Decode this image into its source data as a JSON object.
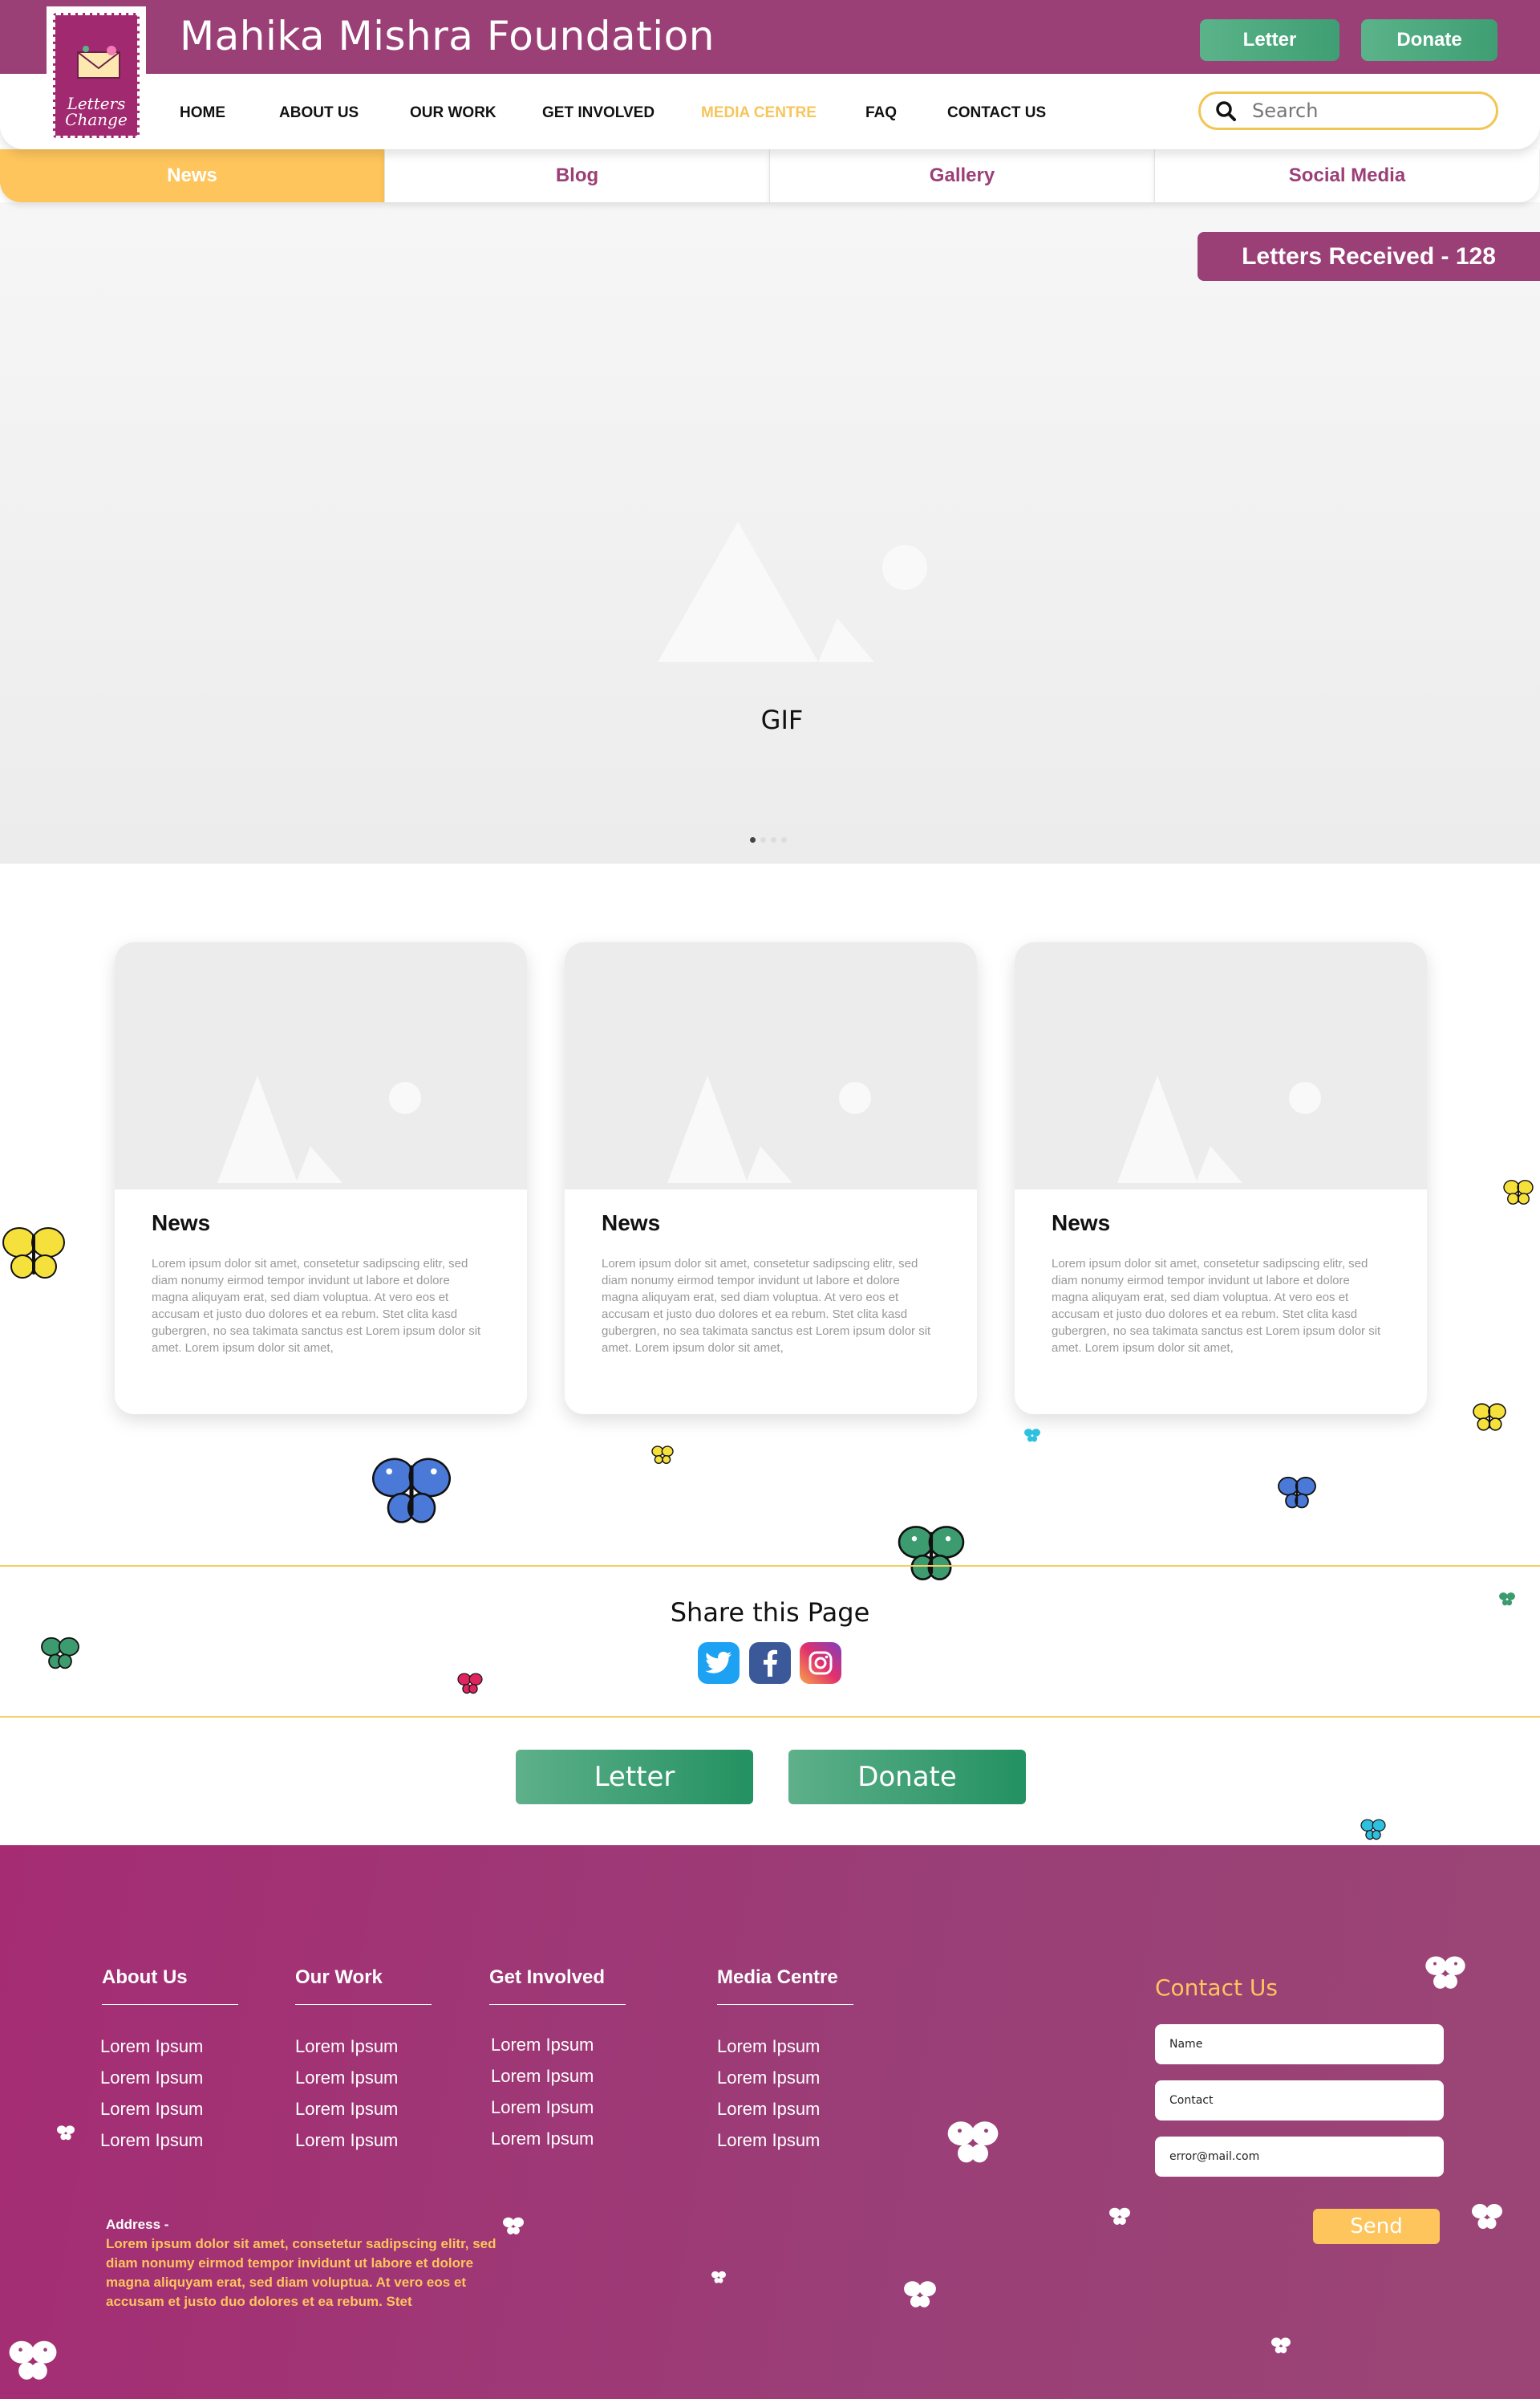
{
  "header": {
    "logo_text_line1": "Letters",
    "logo_text_line2": "Change",
    "title": "Mahika Mishra Foundation",
    "letter_button": "Letter",
    "donate_button": "Donate"
  },
  "nav": {
    "items": [
      "HOME",
      "ABOUT US",
      "OUR WORK",
      "GET INVOLVED",
      "MEDIA CENTRE",
      "FAQ",
      "CONTACT US"
    ],
    "active": "MEDIA CENTRE",
    "search_placeholder": "Search"
  },
  "subtabs": [
    "News",
    "Blog",
    "Gallery",
    "Social Media"
  ],
  "hero": {
    "badge": "Letters Received - 128",
    "caption": "GIF"
  },
  "cards": [
    {
      "title": "News",
      "body": "Lorem ipsum dolor sit amet, consetetur sadipscing elitr, sed diam nonumy eirmod tempor invidunt ut labore et dolore magna aliquyam erat, sed diam voluptua. At vero eos et accusam et justo duo dolores et ea rebum. Stet clita kasd gubergren, no sea takimata sanctus est Lorem ipsum dolor sit amet. Lorem ipsum dolor sit amet,"
    },
    {
      "title": "News",
      "body": "Lorem ipsum dolor sit amet, consetetur sadipscing elitr, sed diam nonumy eirmod tempor invidunt ut labore et dolore magna aliquyam erat, sed diam voluptua. At vero eos et accusam et justo duo dolores et ea rebum. Stet clita kasd gubergren, no sea takimata sanctus est Lorem ipsum dolor sit amet. Lorem ipsum dolor sit amet,"
    },
    {
      "title": "News",
      "body": "Lorem ipsum dolor sit amet, consetetur sadipscing elitr, sed diam nonumy eirmod tempor invidunt ut labore et dolore magna aliquyam erat, sed diam voluptua. At vero eos et accusam et justo duo dolores et ea rebum. Stet clita kasd gubergren, no sea takimata sanctus est Lorem ipsum dolor sit amet. Lorem ipsum dolor sit amet,"
    }
  ],
  "share": {
    "title": "Share this Page",
    "icons": [
      "twitter-icon",
      "facebook-icon",
      "instagram-icon"
    ]
  },
  "cta": {
    "letter": "Letter",
    "donate": "Donate"
  },
  "footer": {
    "columns": [
      {
        "heading": "About Us",
        "links": [
          "Lorem Ipsum",
          "Lorem Ipsum",
          "Lorem Ipsum",
          "Lorem Ipsum"
        ]
      },
      {
        "heading": "Our Work",
        "links": [
          "Lorem Ipsum",
          "Lorem Ipsum",
          "Lorem Ipsum",
          "Lorem Ipsum"
        ]
      },
      {
        "heading": "Get Involved",
        "links": [
          "Lorem Ipsum",
          "Lorem Ipsum",
          "Lorem Ipsum",
          "Lorem Ipsum"
        ]
      },
      {
        "heading": "Media Centre",
        "links": [
          "Lorem Ipsum",
          "Lorem Ipsum",
          "Lorem Ipsum",
          "Lorem Ipsum"
        ]
      }
    ],
    "address_label": "Address -",
    "address": "Lorem ipsum dolor sit amet, consetetur sadipscing elitr, sed diam nonumy eirmod tempor invidunt ut labore et dolore magna aliquyam erat, sed diam voluptua. At vero eos et accusam et justo duo dolores et ea rebum. Stet",
    "contact": {
      "heading": "Contact Us",
      "name_value": "Name",
      "contact_value": "Contact",
      "email_value": "error@mail.com",
      "send": "Send"
    }
  },
  "colors": {
    "brand_purple": "#9b3f77",
    "accent_yellow": "#fec55c",
    "button_green": "#3f9e73"
  }
}
